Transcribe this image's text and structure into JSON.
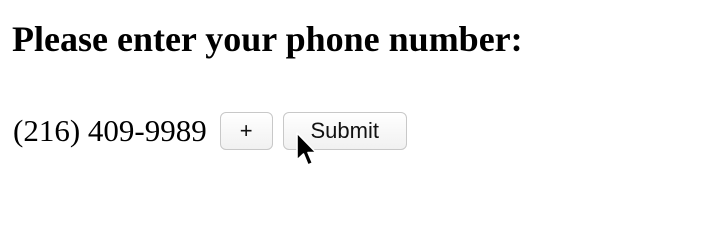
{
  "heading": "Please enter your phone number:",
  "phone": {
    "value": "(216) 409-9989"
  },
  "buttons": {
    "increment_label": "+",
    "submit_label": "Submit"
  },
  "cursor": {
    "icon": "arrow-pointer-icon"
  }
}
